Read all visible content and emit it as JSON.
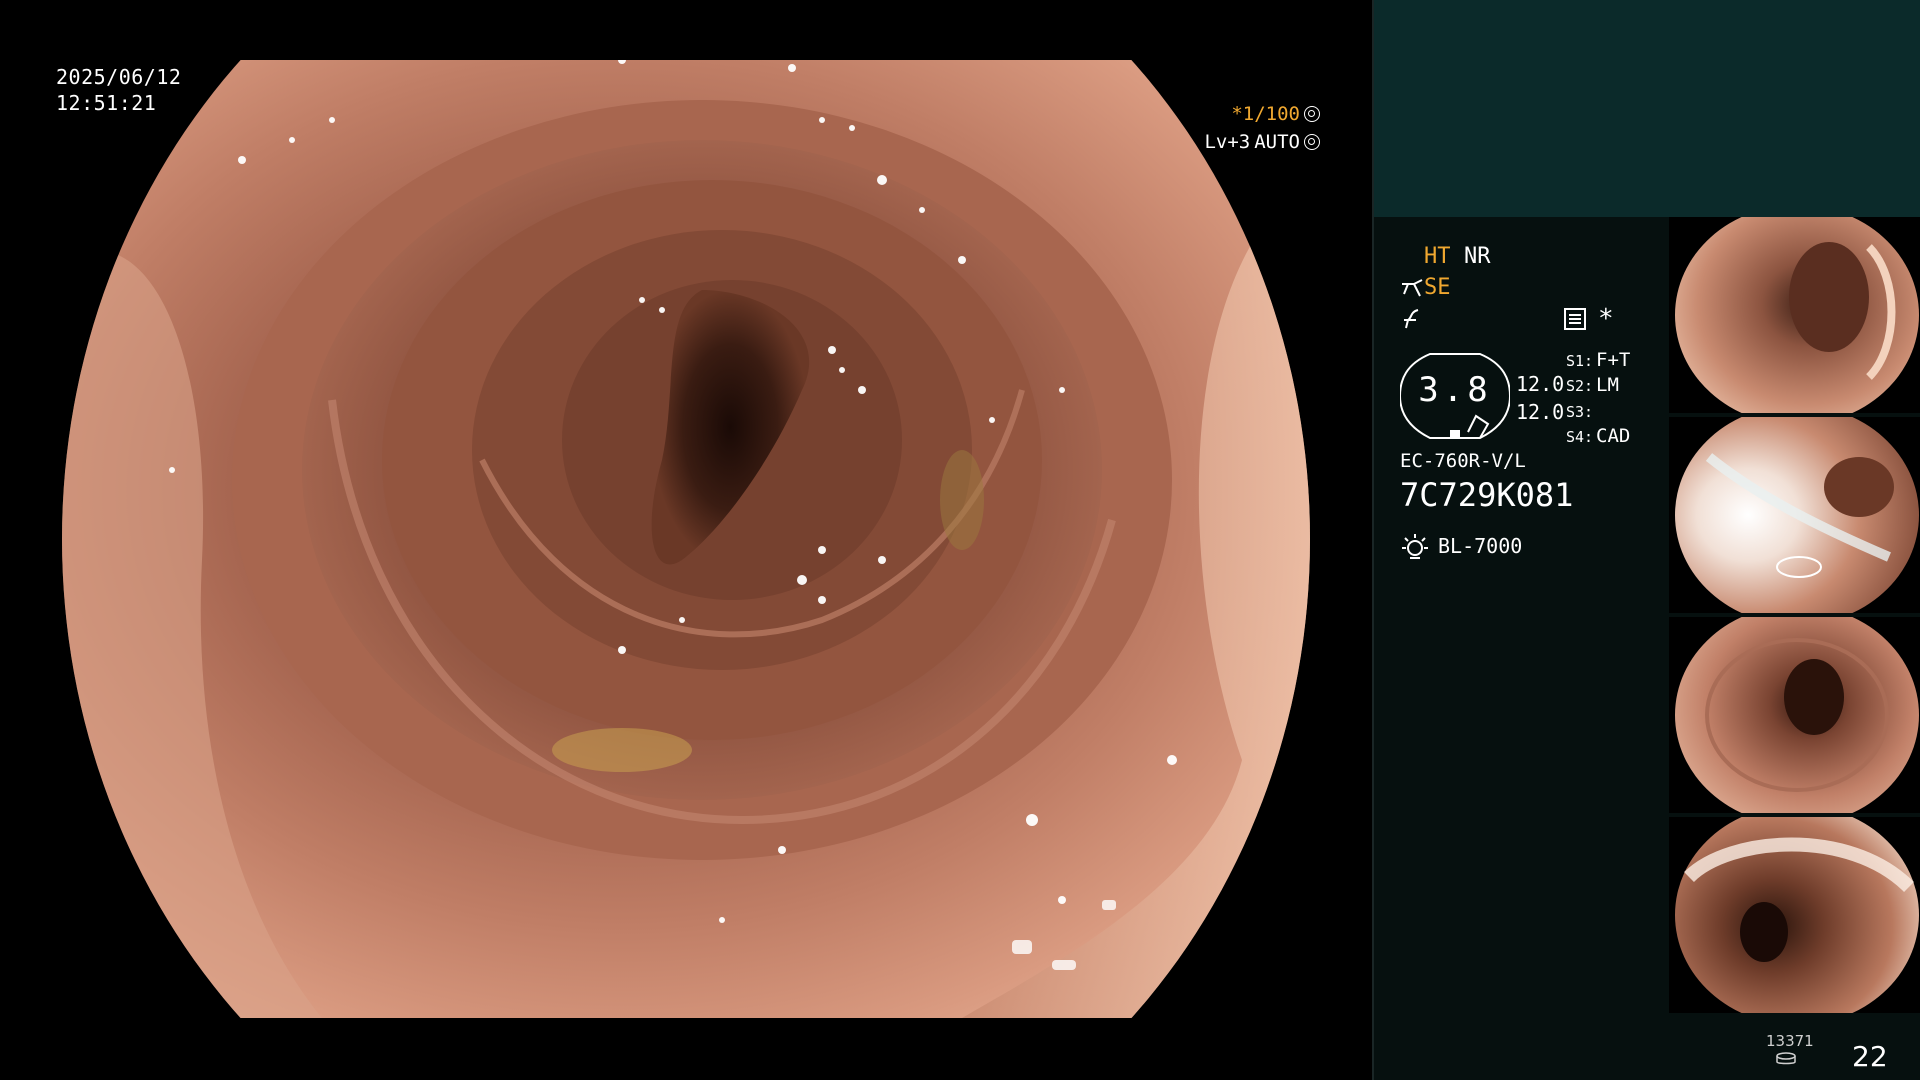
{
  "overlay": {
    "date": "2025/06/12",
    "time": "12:51:21",
    "zoom": "*1/100",
    "level": "Lv+3",
    "mode": "AUTO"
  },
  "panel": {
    "ht": "HT",
    "nr": "NR",
    "se": "SE",
    "gauge_value": "3.8",
    "gauge_side_1": "12.0",
    "gauge_side_2": "12.0",
    "s1_label": "S1:",
    "s1_value": "F+T",
    "s2_label": "S2:",
    "s2_value": "LM",
    "s3_label": "S3:",
    "s3_value": "",
    "s4_label": "S4:",
    "s4_value": "CAD",
    "asterisk": "*",
    "scope_model": "EC-760R-V/L",
    "scope_serial": "7C729K081",
    "light_source": "BL-7000"
  },
  "footer": {
    "image_count": "13371",
    "page_number": "22"
  },
  "icons": [
    "light-source-icon",
    "settings-icon",
    "storage-icon",
    "aperture-icon",
    "mode-icon",
    "scissors-icon",
    "enhance-icon"
  ],
  "colors": {
    "accent": "#f0a830",
    "panel_bg": "#06100f",
    "panel_top_bg": "#0b2a2a",
    "mucosa": "#b9705a"
  }
}
